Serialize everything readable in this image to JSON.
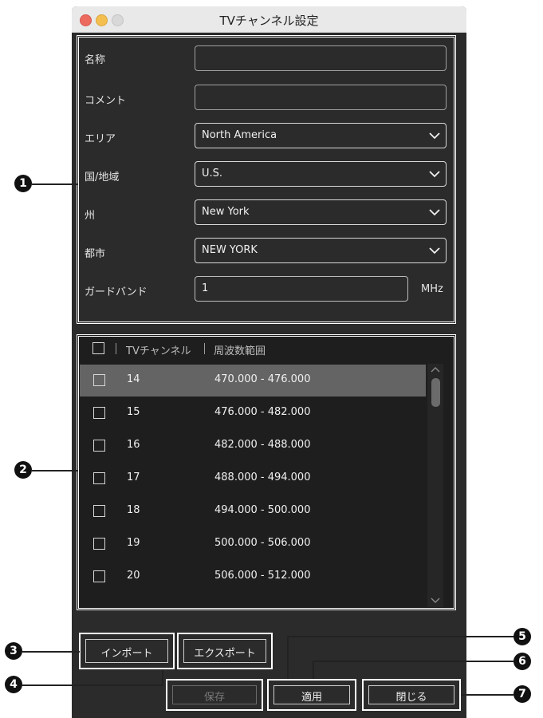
{
  "window": {
    "title": "TVチャンネル設定"
  },
  "form": {
    "name_label": "名称",
    "comment_label": "コメント",
    "area_label": "エリア",
    "area_value": "North America",
    "country_label": "国/地域",
    "country_value": "U.S.",
    "state_label": "州",
    "state_value": "New York",
    "city_label": "都市",
    "city_value": "NEW YORK",
    "guardband_label": "ガードバンド",
    "guardband_value": "1",
    "guardband_unit": "MHz"
  },
  "table": {
    "col_channel": "TVチャンネル",
    "col_range": "周波数範囲",
    "rows": [
      {
        "ch": "14",
        "range": "470.000 - 476.000"
      },
      {
        "ch": "15",
        "range": "476.000 - 482.000"
      },
      {
        "ch": "16",
        "range": "482.000 - 488.000"
      },
      {
        "ch": "17",
        "range": "488.000 - 494.000"
      },
      {
        "ch": "18",
        "range": "494.000 - 500.000"
      },
      {
        "ch": "19",
        "range": "500.000 - 506.000"
      },
      {
        "ch": "20",
        "range": "506.000 - 512.000"
      }
    ]
  },
  "buttons": {
    "import": "インポート",
    "export": "エクスポート",
    "save": "保存",
    "apply": "適用",
    "close": "閉じる"
  },
  "callouts": [
    "1",
    "2",
    "3",
    "4",
    "5",
    "6",
    "7"
  ],
  "colors": {
    "window_bg": "#2b2b2b",
    "selected_row": "#646464",
    "accent_frame": "#ffffff"
  }
}
